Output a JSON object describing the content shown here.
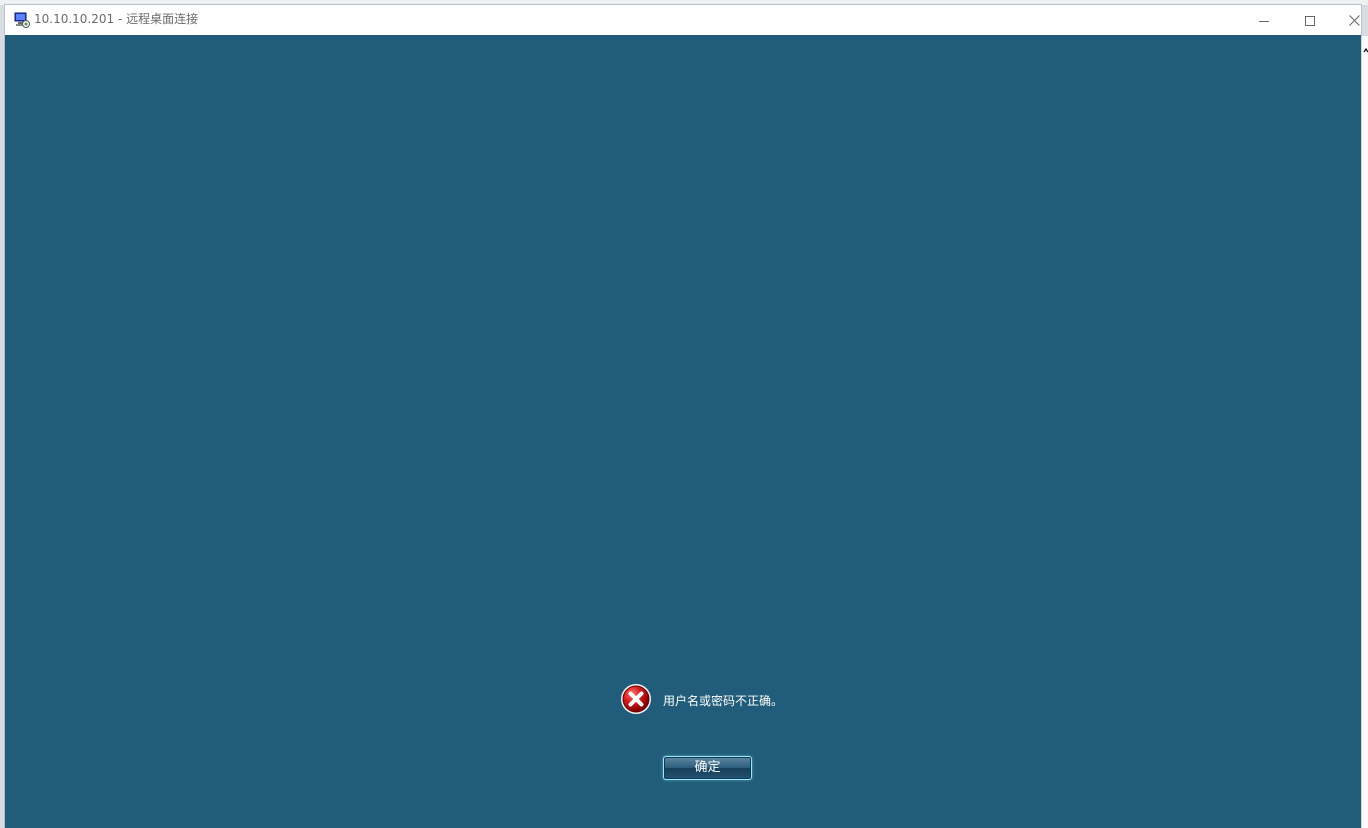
{
  "window": {
    "title": "10.10.10.201 - 远程桌面连接",
    "icon": "remote-desktop-icon",
    "controls": {
      "minimize": "minimize-icon",
      "maximize": "maximize-icon",
      "close": "close-icon"
    }
  },
  "remote_session": {
    "background_color": "#215d7a",
    "error": {
      "icon": "error-icon",
      "message": "用户名或密码不正确。"
    },
    "ok_button": {
      "label": "确定"
    }
  }
}
